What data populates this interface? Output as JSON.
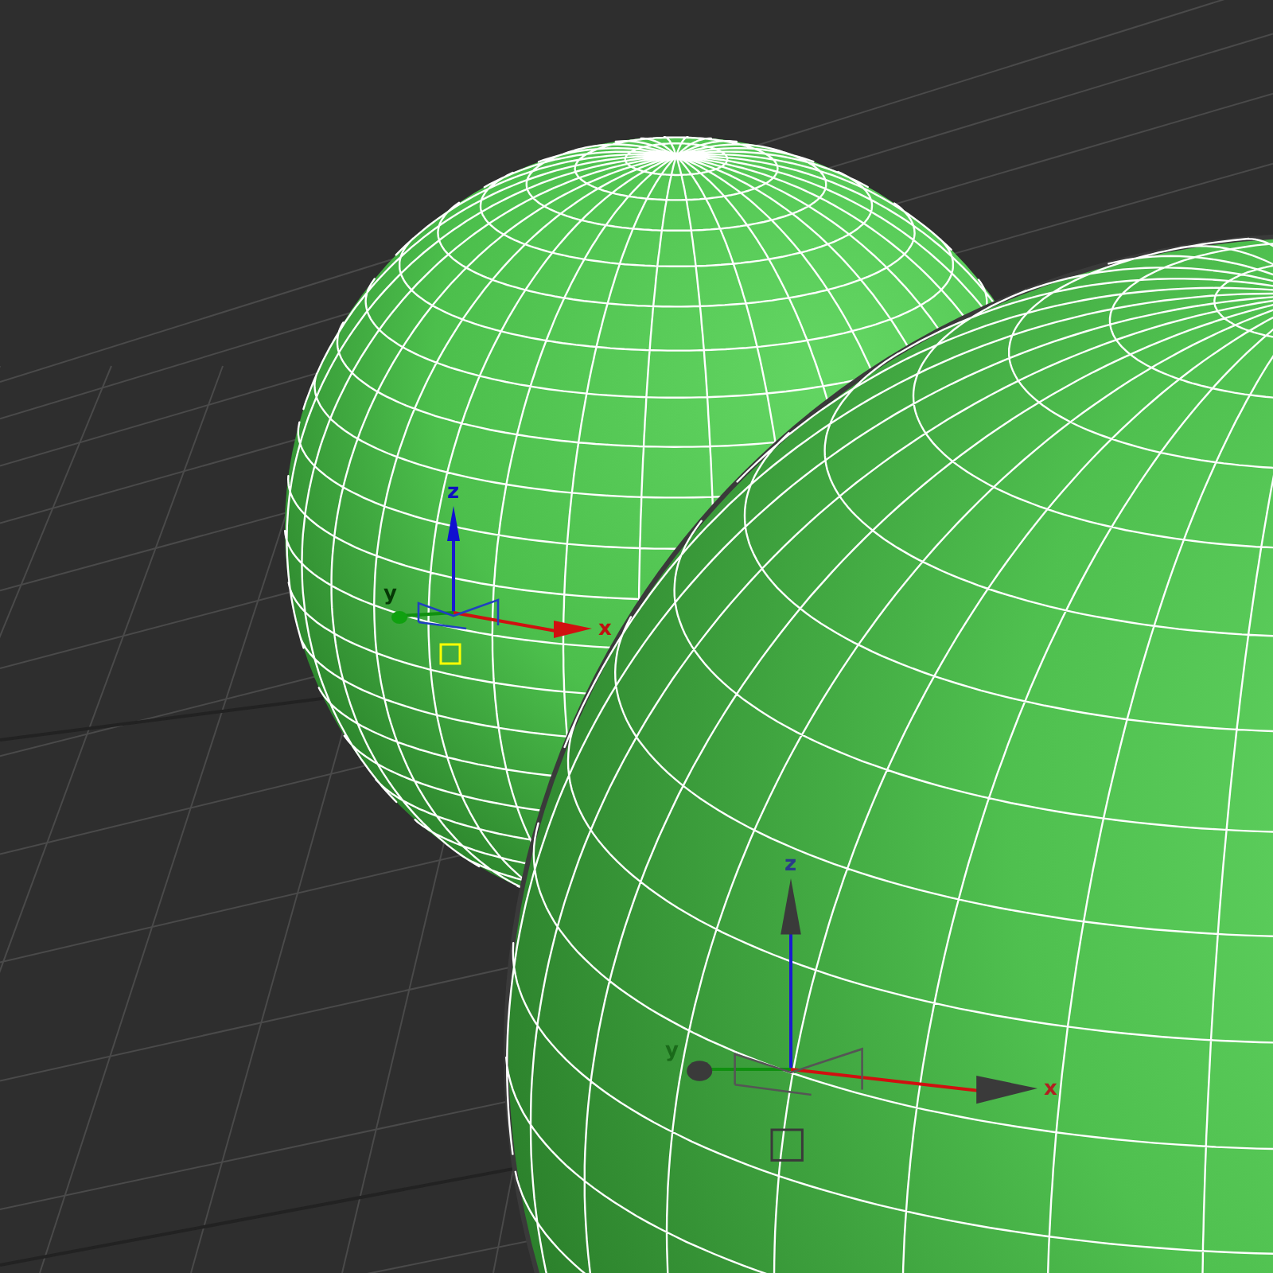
{
  "viewport": {
    "gizmos": [
      {
        "selected": true,
        "axis_labels": [
          "z",
          "y",
          "x"
        ]
      },
      {
        "selected": false,
        "axis_labels": [
          "z",
          "y",
          "x"
        ]
      }
    ]
  }
}
